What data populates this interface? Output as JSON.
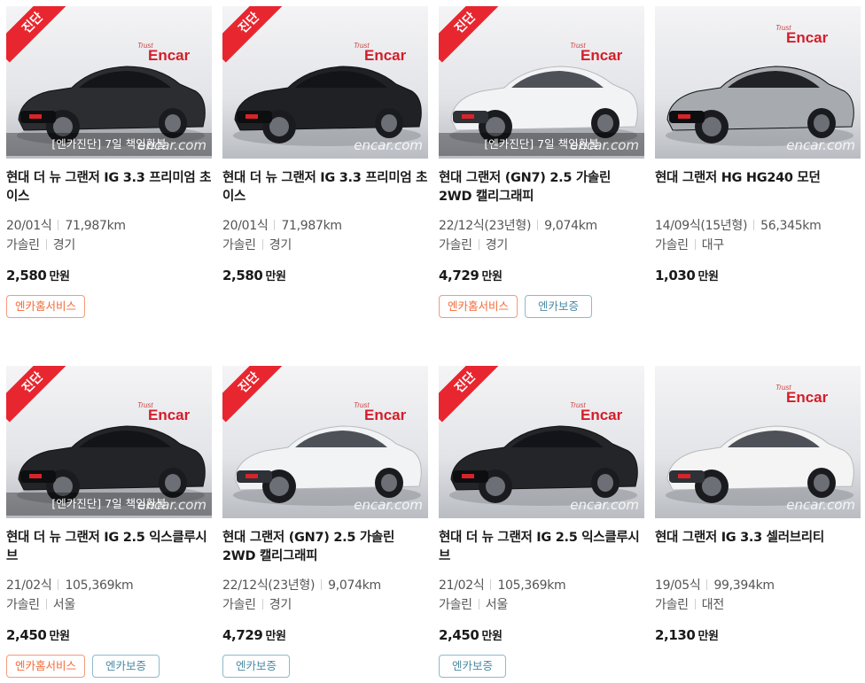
{
  "listings": [
    {
      "title": "현대 더 뉴 그랜저 IG 3.3 프리미엄 초이스",
      "year": "20/01식",
      "mileage": "71,987km",
      "fuel": "가솔린",
      "region": "경기",
      "price": "2,580",
      "unit": "만원",
      "diag": "진단",
      "overlay": "[엔카진단] 7일 책임환불",
      "watermark": "encar.com",
      "logo": "Encar",
      "logo_tag": "Trust",
      "badges": [
        {
          "label": "엔카홈서비스",
          "kind": "home"
        }
      ],
      "car_color": "#2b2d30"
    },
    {
      "title": "현대 더 뉴 그랜저 IG 3.3 프리미엄 초이스",
      "year": "20/01식",
      "mileage": "71,987km",
      "fuel": "가솔린",
      "region": "경기",
      "price": "2,580",
      "unit": "만원",
      "diag": "진단",
      "overlay": "",
      "watermark": "encar.com",
      "logo": "Encar",
      "logo_tag": "Trust",
      "badges": [],
      "car_color": "#1f2124"
    },
    {
      "title": "현대 그랜저 (GN7) 2.5 가솔린 2WD 캘리그래피",
      "year": "22/12식(23년형)",
      "mileage": "9,074km",
      "fuel": "가솔린",
      "region": "경기",
      "price": "4,729",
      "unit": "만원",
      "diag": "진단",
      "overlay": "[엔카진단] 7일 책임환불",
      "watermark": "encar.com",
      "logo": "Encar",
      "logo_tag": "Trust",
      "badges": [
        {
          "label": "엔카홈서비스",
          "kind": "home"
        },
        {
          "label": "엔카보증",
          "kind": "warranty"
        }
      ],
      "car_color": "#f2f3f5"
    },
    {
      "title": "현대 그랜저 HG HG240 모던",
      "year": "14/09식(15년형)",
      "mileage": "56,345km",
      "fuel": "가솔린",
      "region": "대구",
      "price": "1,030",
      "unit": "만원",
      "diag": "",
      "overlay": "",
      "watermark": "encar.com",
      "logo": "Encar",
      "logo_tag": "Trust",
      "badges": [],
      "car_color": "#a7abb0"
    },
    {
      "title": "현대 더 뉴 그랜저 IG 2.5 익스클루시브",
      "year": "21/02식",
      "mileage": "105,369km",
      "fuel": "가솔린",
      "region": "서울",
      "price": "2,450",
      "unit": "만원",
      "diag": "진단",
      "overlay": "[엔카진단] 7일 책임환불",
      "watermark": "encar.com",
      "logo": "Encar",
      "logo_tag": "Trust",
      "badges": [
        {
          "label": "엔카홈서비스",
          "kind": "home"
        },
        {
          "label": "엔카보증",
          "kind": "warranty"
        }
      ],
      "car_color": "#222427"
    },
    {
      "title": "현대 그랜저 (GN7) 2.5 가솔린 2WD 캘리그래피",
      "year": "22/12식(23년형)",
      "mileage": "9,074km",
      "fuel": "가솔린",
      "region": "경기",
      "price": "4,729",
      "unit": "만원",
      "diag": "진단",
      "overlay": "",
      "watermark": "encar.com",
      "logo": "Encar",
      "logo_tag": "Trust",
      "badges": [
        {
          "label": "엔카보증",
          "kind": "warranty"
        }
      ],
      "car_color": "#f2f3f5"
    },
    {
      "title": "현대 더 뉴 그랜저 IG 2.5 익스클루시브",
      "year": "21/02식",
      "mileage": "105,369km",
      "fuel": "가솔린",
      "region": "서울",
      "price": "2,450",
      "unit": "만원",
      "diag": "진단",
      "overlay": "",
      "watermark": "encar.com",
      "logo": "Encar",
      "logo_tag": "Trust",
      "badges": [
        {
          "label": "엔카보증",
          "kind": "warranty"
        }
      ],
      "car_color": "#232528"
    },
    {
      "title": "현대 그랜저 IG 3.3 셀러브리티",
      "year": "19/05식",
      "mileage": "99,394km",
      "fuel": "가솔린",
      "region": "대전",
      "price": "2,130",
      "unit": "만원",
      "diag": "",
      "overlay": "",
      "watermark": "encar.com",
      "logo": "Encar",
      "logo_tag": "Trust",
      "badges": [],
      "car_color": "#f4f4f4"
    }
  ]
}
